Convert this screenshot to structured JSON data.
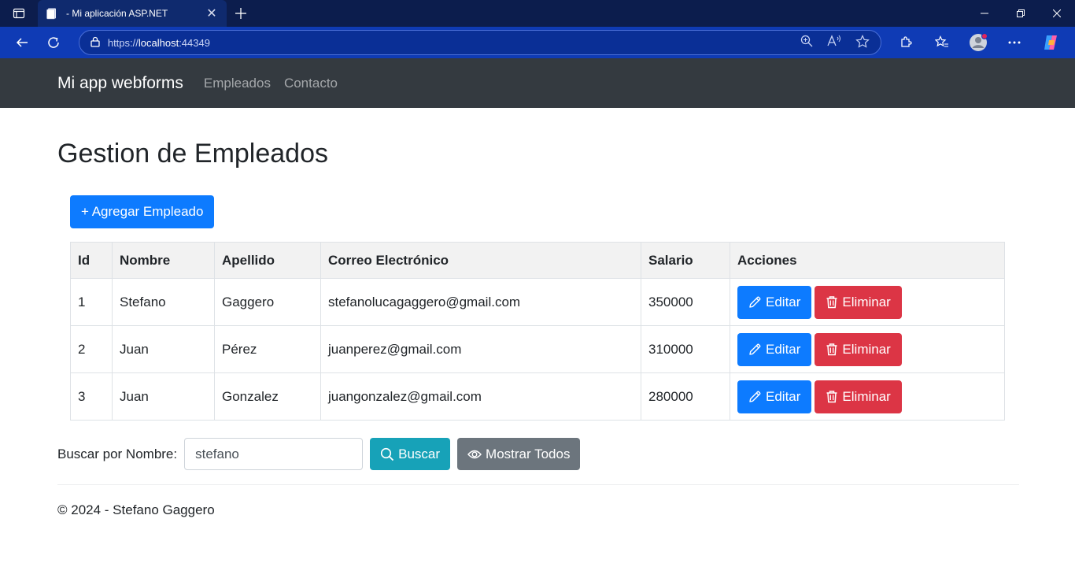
{
  "browser": {
    "tab_title": "- Mi aplicación ASP.NET",
    "url_scheme": "https://",
    "url_host": "localhost",
    "url_port": ":44349"
  },
  "site": {
    "brand": "Mi app webforms",
    "nav": [
      "Empleados",
      "Contacto"
    ]
  },
  "page": {
    "title": "Gestion de Empleados",
    "add_button": "+ Agregar Empleado"
  },
  "table": {
    "headers": [
      "Id",
      "Nombre",
      "Apellido",
      "Correo Electrónico",
      "Salario",
      "Acciones"
    ],
    "rows": [
      {
        "id": "1",
        "nombre": "Stefano",
        "apellido": "Gaggero",
        "correo": "stefanolucagaggero@gmail.com",
        "salario": "350000"
      },
      {
        "id": "2",
        "nombre": "Juan",
        "apellido": "Pérez",
        "correo": "juanperez@gmail.com",
        "salario": "310000"
      },
      {
        "id": "3",
        "nombre": "Juan",
        "apellido": "Gonzalez",
        "correo": "juangonzalez@gmail.com",
        "salario": "280000"
      }
    ],
    "edit_label": "Editar",
    "delete_label": "Eliminar"
  },
  "search": {
    "label": "Buscar por Nombre:",
    "value": "stefano",
    "search_button": "Buscar",
    "show_all_button": "Mostrar Todos"
  },
  "footer": {
    "text": "© 2024 - Stefano Gaggero"
  },
  "colors": {
    "primary": "#0d7bff",
    "danger": "#dc3545",
    "info": "#17a2b8",
    "secondary": "#6c757d",
    "navbar": "#343a40"
  }
}
